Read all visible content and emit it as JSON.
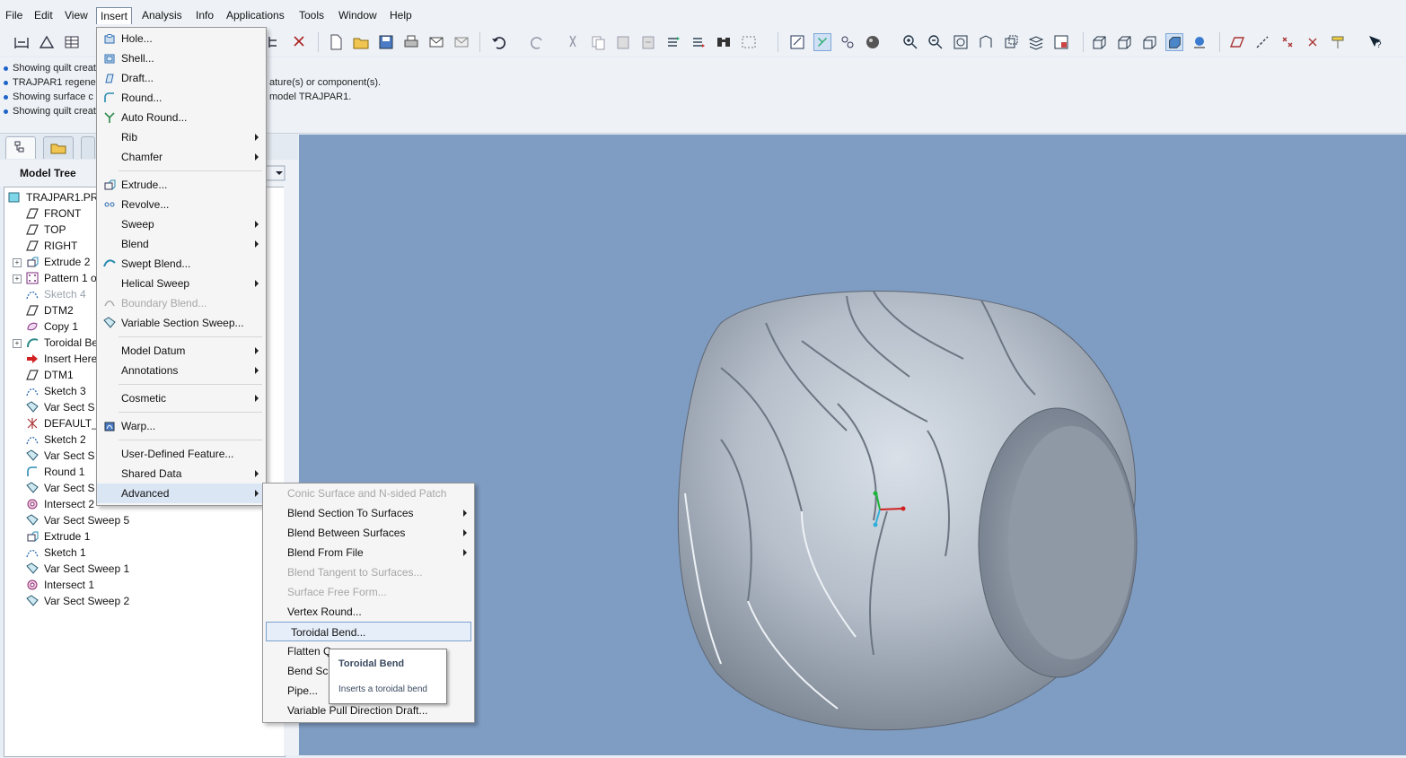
{
  "menubar": {
    "items": [
      {
        "name": "menu-file",
        "label": "File"
      },
      {
        "name": "menu-edit",
        "label": "Edit"
      },
      {
        "name": "menu-view",
        "label": "View"
      },
      {
        "name": "menu-insert",
        "label": "Insert"
      },
      {
        "name": "menu-analysis",
        "label": "Analysis"
      },
      {
        "name": "menu-info",
        "label": "Info"
      },
      {
        "name": "menu-applications",
        "label": "Applications"
      },
      {
        "name": "menu-tools",
        "label": "Tools"
      },
      {
        "name": "menu-window",
        "label": "Window"
      },
      {
        "name": "menu-help",
        "label": "Help"
      }
    ]
  },
  "messages": [
    {
      "left": "Showing quilt creat",
      "tail": ""
    },
    {
      "left": "TRAJPAR1 regener",
      "tail": "ature(s) or component(s)."
    },
    {
      "left": "Showing surface c",
      "tail": "model TRAJPAR1."
    },
    {
      "left": "Showing quilt creat",
      "tail": ""
    }
  ],
  "model_tree": {
    "title": "Model Tree",
    "items": [
      {
        "label": "TRAJPAR1.PRT",
        "icon": "part-icon",
        "dim": false
      },
      {
        "label": "FRONT",
        "icon": "datum-plane-icon",
        "dim": false
      },
      {
        "label": "TOP",
        "icon": "datum-plane-icon",
        "dim": false
      },
      {
        "label": "RIGHT",
        "icon": "datum-plane-icon",
        "dim": false
      },
      {
        "label": "Extrude 2",
        "icon": "extrude-icon",
        "dim": false,
        "expand": true
      },
      {
        "label": "Pattern 1 o",
        "icon": "pattern-icon",
        "dim": false,
        "expand": true
      },
      {
        "label": "Sketch 4",
        "icon": "sketch-icon",
        "dim": true
      },
      {
        "label": "DTM2",
        "icon": "datum-plane-icon",
        "dim": false
      },
      {
        "label": "Copy 1",
        "icon": "copy-icon",
        "dim": false
      },
      {
        "label": "Toroidal Be",
        "icon": "toroidal-bend-icon",
        "dim": false,
        "expand": true
      },
      {
        "label": "Insert Here",
        "icon": "insert-here-arrow-icon",
        "dim": false
      },
      {
        "label": "DTM1",
        "icon": "datum-plane-icon",
        "dim": false
      },
      {
        "label": "Sketch 3",
        "icon": "sketch-icon",
        "dim": false
      },
      {
        "label": "Var Sect S",
        "icon": "var-sect-sweep-icon",
        "dim": false
      },
      {
        "label": "DEFAULT_",
        "icon": "csys-icon",
        "dim": false
      },
      {
        "label": "Sketch 2",
        "icon": "sketch-icon",
        "dim": false
      },
      {
        "label": "Var Sect S",
        "icon": "var-sect-sweep-icon",
        "dim": false
      },
      {
        "label": "Round 1",
        "icon": "round-icon",
        "dim": false
      },
      {
        "label": "Var Sect S",
        "icon": "var-sect-sweep-icon",
        "dim": false
      },
      {
        "label": "Intersect 2",
        "icon": "intersect-icon",
        "dim": false
      },
      {
        "label": "Var Sect Sweep 5",
        "icon": "var-sect-sweep-icon",
        "dim": false
      },
      {
        "label": "Extrude 1",
        "icon": "extrude-icon",
        "dim": false
      },
      {
        "label": "Sketch 1",
        "icon": "sketch-icon",
        "dim": false
      },
      {
        "label": "Var Sect Sweep 1",
        "icon": "var-sect-sweep-icon",
        "dim": false
      },
      {
        "label": "Intersect 1",
        "icon": "intersect-icon",
        "dim": false
      },
      {
        "label": "Var Sect Sweep 2",
        "icon": "var-sect-sweep-icon",
        "dim": false
      }
    ]
  },
  "insert_menu": {
    "items": [
      {
        "label": "Hole...",
        "icon": "hole-icon"
      },
      {
        "label": "Shell...",
        "icon": "shell-icon"
      },
      {
        "label": "Draft...",
        "icon": "draft-icon"
      },
      {
        "label": "Round...",
        "icon": "round-icon"
      },
      {
        "label": "Auto Round...",
        "icon": "auto-round-icon"
      },
      {
        "label": "Rib",
        "submenu": true
      },
      {
        "label": "Chamfer",
        "submenu": true
      },
      {
        "sep": true
      },
      {
        "label": "Extrude...",
        "icon": "extrude-icon"
      },
      {
        "label": "Revolve...",
        "icon": "revolve-icon"
      },
      {
        "label": "Sweep",
        "submenu": true
      },
      {
        "label": "Blend",
        "submenu": true
      },
      {
        "label": "Swept Blend...",
        "icon": "swept-blend-icon"
      },
      {
        "label": "Helical Sweep",
        "submenu": true
      },
      {
        "label": "Boundary Blend...",
        "icon": "boundary-blend-icon",
        "disabled": true
      },
      {
        "label": "Variable Section Sweep...",
        "icon": "var-sect-sweep-icon"
      },
      {
        "sep": true
      },
      {
        "label": "Model Datum",
        "submenu": true
      },
      {
        "label": "Annotations",
        "submenu": true
      },
      {
        "sep": true
      },
      {
        "label": "Cosmetic",
        "submenu": true
      },
      {
        "sep": true
      },
      {
        "label": "Warp...",
        "icon": "warp-icon"
      },
      {
        "sep": true
      },
      {
        "label": "User-Defined Feature..."
      },
      {
        "label": "Shared Data",
        "submenu": true
      },
      {
        "label": "Advanced",
        "submenu": true,
        "highlight": true
      }
    ]
  },
  "advanced_menu": {
    "items": [
      {
        "label": "Conic Surface and N-sided Patch",
        "disabled": true
      },
      {
        "label": "Blend Section To Surfaces",
        "submenu": true
      },
      {
        "label": "Blend Between Surfaces",
        "submenu": true
      },
      {
        "label": "Blend From File",
        "submenu": true
      },
      {
        "label": "Blend Tangent to Surfaces...",
        "disabled": true
      },
      {
        "label": "Surface Free Form...",
        "disabled": true
      },
      {
        "label": "Vertex Round..."
      },
      {
        "label": "Toroidal Bend...",
        "highlight": true
      },
      {
        "label": "Flatten Q"
      },
      {
        "label": "Bend Sc"
      },
      {
        "label": "Pipe..."
      },
      {
        "label": "Variable Pull Direction Draft..."
      }
    ]
  },
  "tooltip": {
    "title": "Toroidal Bend",
    "description": "Inserts a toroidal bend"
  },
  "colors": {
    "viewport_bg": "#7f9cc2",
    "menu_highlight": "#dbe6f5",
    "tire_surface": "#b9c2cc"
  }
}
